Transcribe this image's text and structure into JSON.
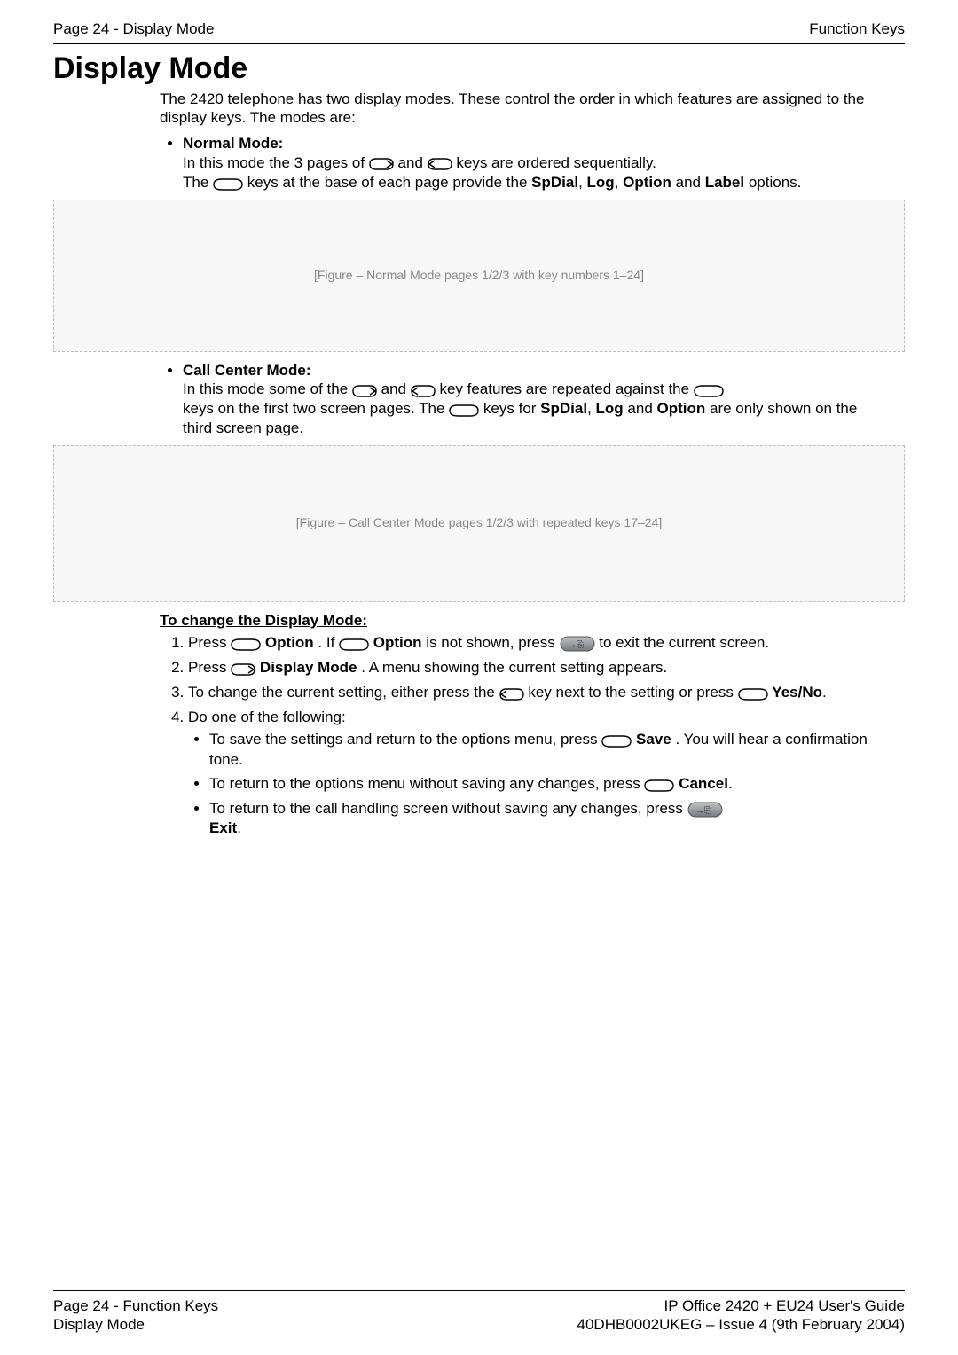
{
  "header": {
    "left": "Page 24 - Display Mode",
    "right": "Function Keys"
  },
  "title": "Display Mode",
  "intro": "The 2420 telephone has two display modes. These control the order in which features are assigned to the display keys. The modes are:",
  "normal": {
    "name": "Normal Mode:",
    "line1_a": "In this mode the 3 pages of ",
    "line1_b": " and ",
    "line1_c": " keys are ordered sequentially.",
    "line2_a": "The ",
    "line2_b": " keys at the base of each page provide the ",
    "labels_join": ", ",
    "labels_and": " and ",
    "line2_end": " options.",
    "labels": [
      "SpDial",
      "Log",
      "Option",
      "Label"
    ]
  },
  "figure1_caption": "[Figure – Normal Mode pages 1/2/3 with key numbers 1–24]",
  "callcenter": {
    "name": "Call Center Mode:",
    "line1_a": "In this mode some of the ",
    "line1_b": " and ",
    "line1_c": " key features are repeated against the ",
    "line2_a": "keys on the first two screen pages. The ",
    "line2_b": " keys for ",
    "line2_end": " are only shown on the third screen page.",
    "labels": [
      "SpDial",
      "Log",
      "Option"
    ]
  },
  "figure2_caption": "[Figure – Call Center Mode pages 1/2/3 with repeated keys 17–24]",
  "procedure": {
    "heading": "To change the Display Mode:",
    "step1_a": "Press ",
    "step1_opt": "Option",
    "step1_b": ". If ",
    "step1_c": " is not shown, press ",
    "step1_d": " to exit the current screen.",
    "step2_a": "Press ",
    "step2_dm": "Display Mode",
    "step2_b": ". A menu showing the current setting appears.",
    "step3_a": "To change the current setting, either press the ",
    "step3_b": " key next to the setting or press ",
    "step3_yn": "Yes/No",
    "step4": "Do one of the following:",
    "sub1_a": "To save the settings and return to the options menu, press ",
    "sub1_save": "Save",
    "sub1_b": ". You will hear a confirmation tone.",
    "sub2_a": "To return to the options menu without saving any changes, press ",
    "sub2_cancel": "Cancel",
    "sub3_a": "To return to the call handling screen without saving any changes, press ",
    "sub3_exit": "Exit",
    "period": "."
  },
  "footer": {
    "left1": "Page 24 - Function Keys",
    "left2": "Display Mode",
    "right1": "IP Office 2420 + EU24 User's Guide",
    "right2": "40DHB0002UKEG – Issue 4 (9th February 2004)"
  }
}
